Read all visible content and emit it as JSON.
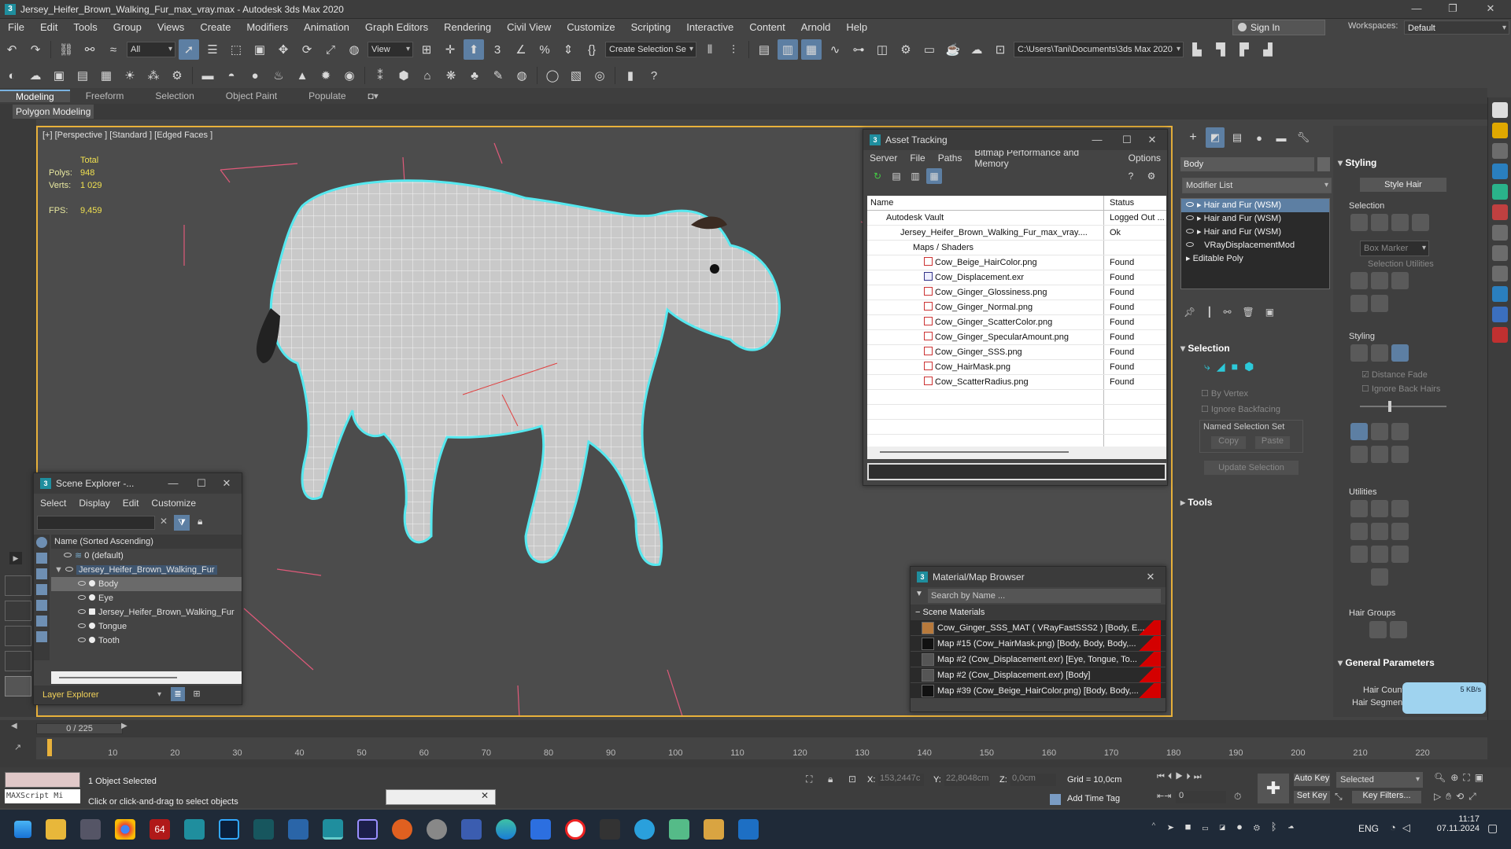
{
  "window": {
    "title": "Jersey_Heifer_Brown_Walking_Fur_max_vray.max - Autodesk 3ds Max 2020"
  },
  "menu": [
    "File",
    "Edit",
    "Tools",
    "Group",
    "Views",
    "Create",
    "Modifiers",
    "Animation",
    "Graph Editors",
    "Rendering",
    "Civil View",
    "Customize",
    "Scripting",
    "Interactive",
    "Content",
    "Arnold",
    "Help"
  ],
  "account": {
    "sign_in": "Sign In",
    "workspaces_label": "Workspaces:",
    "workspace": "Default"
  },
  "toolbar": {
    "filter": "All",
    "ref_coord": "View",
    "selection_set": "Create Selection Se",
    "project_path": "C:\\Users\\Tani\\Documents\\3ds Max 2020"
  },
  "ribbon": {
    "tabs": [
      "Modeling",
      "Freeform",
      "Selection",
      "Object Paint",
      "Populate"
    ],
    "sub": "Polygon Modeling"
  },
  "viewport": {
    "label": "[+] [Perspective ] [Standard ] [Edged Faces ]",
    "stats": {
      "total_label": "Total",
      "polys_label": "Polys:",
      "polys": "948",
      "verts_label": "Verts:",
      "verts": "1 029",
      "fps_label": "FPS:",
      "fps": "9,459"
    }
  },
  "asset_tracking": {
    "title": "Asset Tracking",
    "menu": [
      "Server",
      "File",
      "Paths",
      "Bitmap Performance and Memory",
      "Options"
    ],
    "col_name": "Name",
    "col_status": "Status",
    "rows": [
      {
        "name": "Autodesk Vault",
        "status": "Logged Out ..."
      },
      {
        "name": "Jersey_Heifer_Brown_Walking_Fur_max_vray....",
        "status": "Ok"
      },
      {
        "name": "Maps / Shaders",
        "status": ""
      },
      {
        "name": "Cow_Beige_HairColor.png",
        "status": "Found"
      },
      {
        "name": "Cow_Displacement.exr",
        "status": "Found"
      },
      {
        "name": "Cow_Ginger_Glossiness.png",
        "status": "Found"
      },
      {
        "name": "Cow_Ginger_Normal.png",
        "status": "Found"
      },
      {
        "name": "Cow_Ginger_ScatterColor.png",
        "status": "Found"
      },
      {
        "name": "Cow_Ginger_SpecularAmount.png",
        "status": "Found"
      },
      {
        "name": "Cow_Ginger_SSS.png",
        "status": "Found"
      },
      {
        "name": "Cow_HairMask.png",
        "status": "Found"
      },
      {
        "name": "Cow_ScatterRadius.png",
        "status": "Found"
      }
    ]
  },
  "scene_explorer": {
    "title": "Scene Explorer -...",
    "menu": [
      "Select",
      "Display",
      "Edit",
      "Customize"
    ],
    "header": "Name (Sorted Ascending)",
    "items": [
      "0 (default)",
      "Jersey_Heifer_Brown_Walking_Fur",
      "Body",
      "Eye",
      "Jersey_Heifer_Brown_Walking_Fur",
      "Tongue",
      "Tooth"
    ],
    "footer": "Layer Explorer"
  },
  "material_browser": {
    "title": "Material/Map Browser",
    "search": "Search by Name ...",
    "group": "Scene Materials",
    "items": [
      "Cow_Ginger_SSS_MAT  ( VRayFastSSS2 )  [Body, E...",
      "Map #15 (Cow_HairMask.png) [Body, Body, Body,...",
      "Map #2 (Cow_Displacement.exr)  [Eye, Tongue, To...",
      "Map #2 (Cow_Displacement.exr)  [Body]",
      "Map #39 (Cow_Beige_HairColor.png) [Body, Body,..."
    ]
  },
  "command_panel": {
    "object_name": "Body",
    "modifier_list": "Modifier List",
    "stack": [
      "Hair and Fur (WSM)",
      "Hair and Fur (WSM)",
      "Hair and Fur (WSM)",
      "VRayDisplacementMod",
      "Editable Poly"
    ],
    "selection": "Selection",
    "by_vertex": "By Vertex",
    "ignore_backfacing": "Ignore Backfacing",
    "named_sel": "Named Selection Set",
    "copy": "Copy",
    "paste": "Paste",
    "update_selection": "Update Selection",
    "tools": "Tools"
  },
  "styling": {
    "title": "Styling",
    "style_hair": "Style Hair",
    "selection": "Selection",
    "box_marker": "Box Marker",
    "selection_utilities": "Selection Utilities",
    "styling": "Styling",
    "distance_fade": "Distance Fade",
    "ignore_back_hairs": "Ignore Back Hairs",
    "utilities": "Utilities",
    "hair_groups": "Hair Groups",
    "general_parameters": "General Parameters",
    "hair_count": "Hair Count",
    "hair_segments": "Hair Segments",
    "net_speed": "5 KB/s"
  },
  "timeline": {
    "frame": "0 / 225",
    "ticks": [
      "10",
      "20",
      "30",
      "40",
      "50",
      "60",
      "70",
      "80",
      "90",
      "100",
      "110",
      "120",
      "130",
      "140",
      "150",
      "160",
      "170",
      "180",
      "190",
      "200",
      "210",
      "220"
    ]
  },
  "status": {
    "selected": "1 Object Selected",
    "hint": "Click or click-and-drag to select objects",
    "maxscript": "MAXScript Mi",
    "x_label": "X:",
    "x": "153,2447c",
    "y_label": "Y:",
    "y": "22,8048cm",
    "z_label": "Z:",
    "z": "0,0cm",
    "grid": "Grid = 10,0cm",
    "add_time_tag": "Add Time Tag",
    "auto_key": "Auto Key",
    "set_key": "Set Key",
    "selected_dd": "Selected",
    "key_filters": "Key Filters...",
    "frame_field": "0"
  },
  "taskbar": {
    "lang": "ENG",
    "time": "11:17",
    "date": "07.11.2024",
    "badge": "64"
  }
}
